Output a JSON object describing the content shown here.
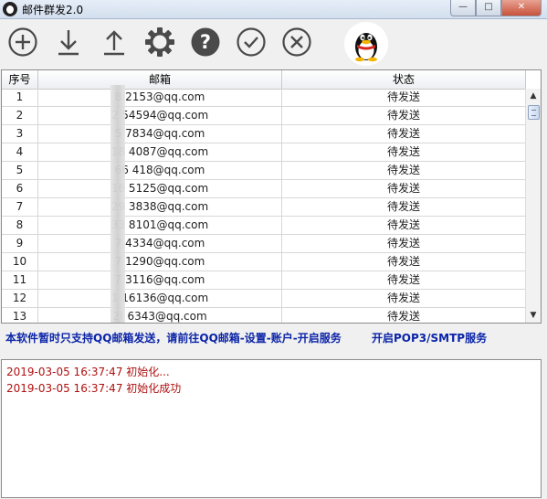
{
  "window": {
    "title": "邮件群发2.0"
  },
  "toolbar": {
    "tools": [
      {
        "name": "add-icon"
      },
      {
        "name": "download-icon"
      },
      {
        "name": "upload-icon"
      },
      {
        "name": "settings-icon"
      },
      {
        "name": "help-icon"
      },
      {
        "name": "check-icon"
      },
      {
        "name": "cancel-icon"
      }
    ],
    "logo": "qq-penguin-icon"
  },
  "table": {
    "headers": [
      "序号",
      "邮箱",
      "状态"
    ],
    "rows": [
      {
        "index": "1",
        "email": "8   2153@qq.com",
        "status": "待发送"
      },
      {
        "index": "2",
        "email": "2   54594@qq.com",
        "status": "待发送"
      },
      {
        "index": "3",
        "email": "5   7834@qq.com",
        "status": "待发送"
      },
      {
        "index": "4",
        "email": "18   4087@qq.com",
        "status": "待发送"
      },
      {
        "index": "5",
        "email": "66   418@qq.com",
        "status": "待发送"
      },
      {
        "index": "6",
        "email": "16   5125@qq.com",
        "status": "待发送"
      },
      {
        "index": "7",
        "email": "29   3838@qq.com",
        "status": "待发送"
      },
      {
        "index": "8",
        "email": "33   8101@qq.com",
        "status": "待发送"
      },
      {
        "index": "9",
        "email": "7   4334@qq.com",
        "status": "待发送"
      },
      {
        "index": "10",
        "email": "7   1290@qq.com",
        "status": "待发送"
      },
      {
        "index": "11",
        "email": "7   3116@qq.com",
        "status": "待发送"
      },
      {
        "index": "12",
        "email": "1   16136@qq.com",
        "status": "待发送"
      },
      {
        "index": "13",
        "email": "2(   6343@qq.com",
        "status": "待发送"
      }
    ]
  },
  "notice": {
    "text": "本软件暂时只支持QQ邮箱发送，请前往QQ邮箱-设置-账户-开启服务",
    "link": "开启POP3/SMTP服务"
  },
  "log": [
    {
      "time": "2019-03-05 16:37:47",
      "message": "初始化..."
    },
    {
      "time": "2019-03-05 16:37:47",
      "message": "初始化成功"
    }
  ],
  "colors": {
    "notice": "#0b24a8",
    "log": "#b01010"
  }
}
